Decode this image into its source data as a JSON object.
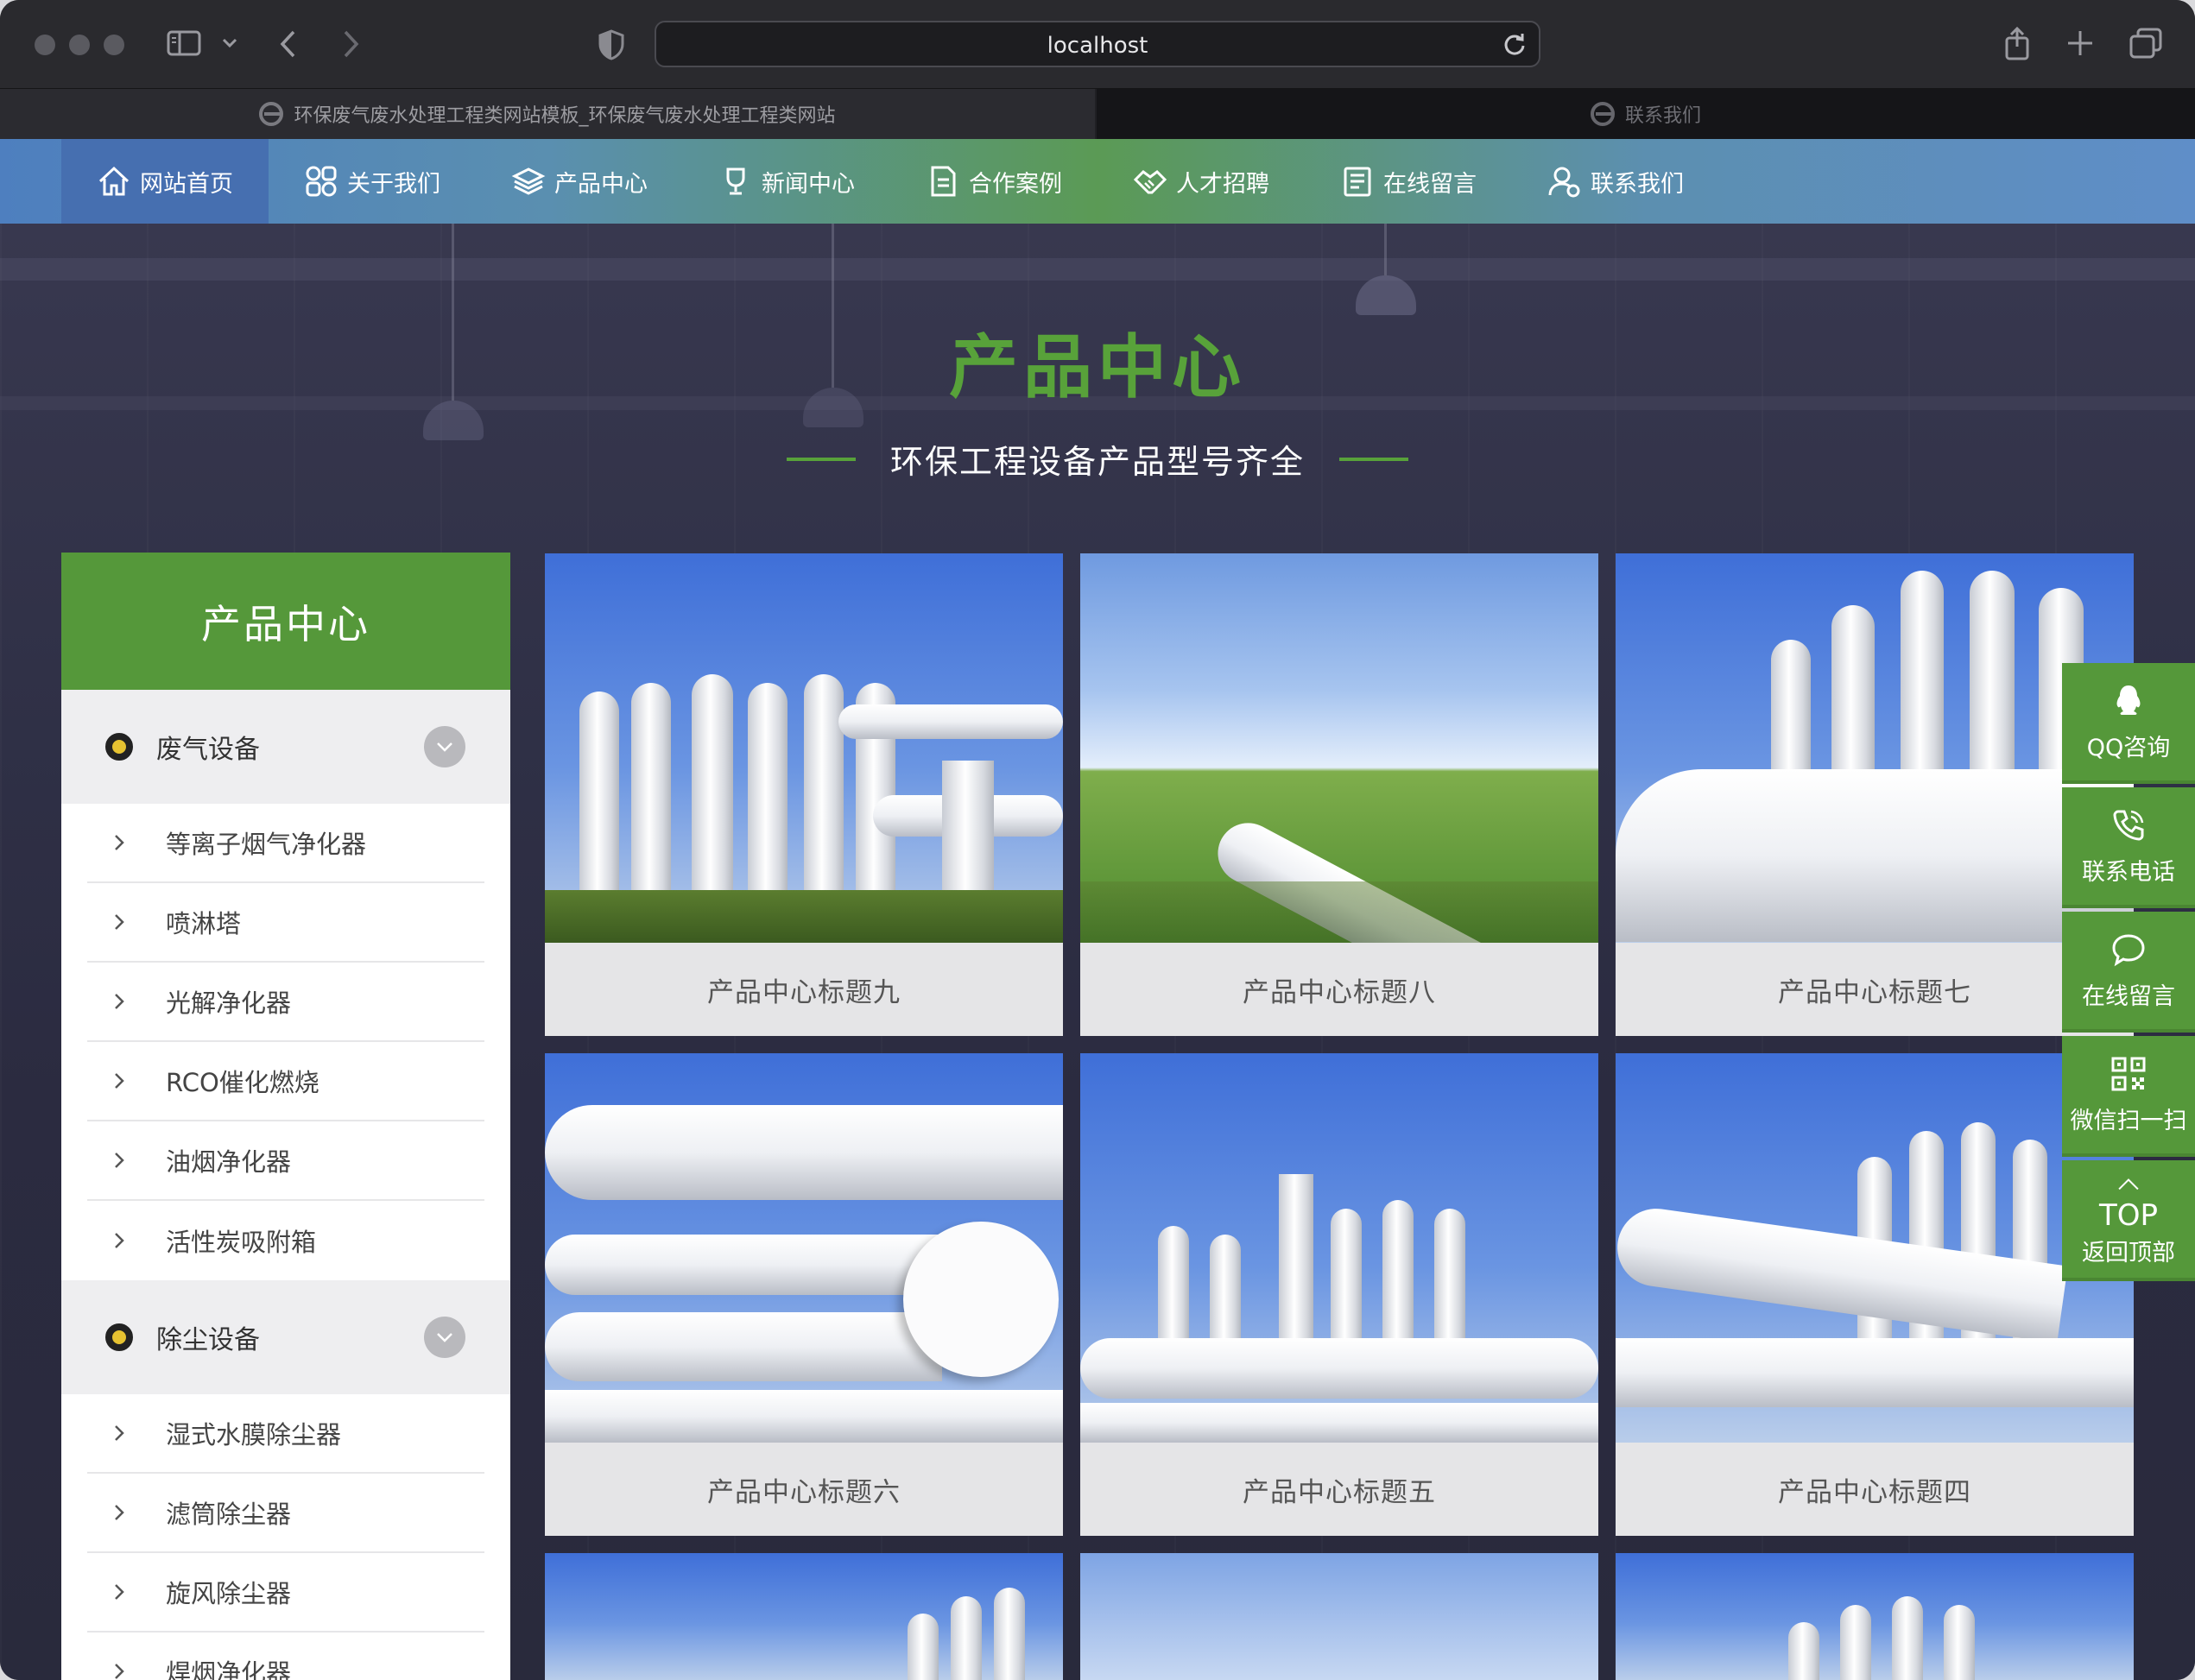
{
  "browser": {
    "url": "localhost",
    "tabs": [
      {
        "title": "环保废气废水处理工程类网站模板_环保废气废水处理工程类网站",
        "active": true
      },
      {
        "title": "联系我们",
        "active": false
      }
    ]
  },
  "nav": {
    "items": [
      {
        "label": "网站首页",
        "icon": "home-icon",
        "active": true
      },
      {
        "label": "关于我们",
        "icon": "grid-icon",
        "active": false
      },
      {
        "label": "产品中心",
        "icon": "layers-icon",
        "active": false
      },
      {
        "label": "新闻中心",
        "icon": "trophy-icon",
        "active": false
      },
      {
        "label": "合作案例",
        "icon": "document-icon",
        "active": false
      },
      {
        "label": "人才招聘",
        "icon": "handshake-icon",
        "active": false
      },
      {
        "label": "在线留言",
        "icon": "clipboard-icon",
        "active": false
      },
      {
        "label": "联系我们",
        "icon": "user-icon",
        "active": false
      }
    ]
  },
  "hero": {
    "title": "产品中心",
    "subtitle": "环保工程设备产品型号齐全"
  },
  "sidebar": {
    "title": "产品中心",
    "categories": [
      {
        "label": "废气设备",
        "items": [
          "等离子烟气净化器",
          "喷淋塔",
          "光解净化器",
          "RCO催化燃烧",
          "油烟净化器",
          "活性炭吸附箱"
        ]
      },
      {
        "label": "除尘设备",
        "items": [
          "湿式水膜除尘器",
          "滤筒除尘器",
          "旋风除尘器",
          "焊烟净化器"
        ]
      }
    ]
  },
  "products": [
    {
      "title": "产品中心标题九"
    },
    {
      "title": "产品中心标题八"
    },
    {
      "title": "产品中心标题七"
    },
    {
      "title": "产品中心标题六"
    },
    {
      "title": "产品中心标题五"
    },
    {
      "title": "产品中心标题四"
    }
  ],
  "float_panel": {
    "qq": "QQ咨询",
    "phone": "联系电话",
    "message": "在线留言",
    "wechat": "微信扫一扫",
    "top_big": "TOP",
    "top_small": "返回顶部"
  },
  "colors": {
    "brand_green": "#55983a",
    "hero_green": "#58a23a",
    "nav_active": "#466fb0"
  }
}
